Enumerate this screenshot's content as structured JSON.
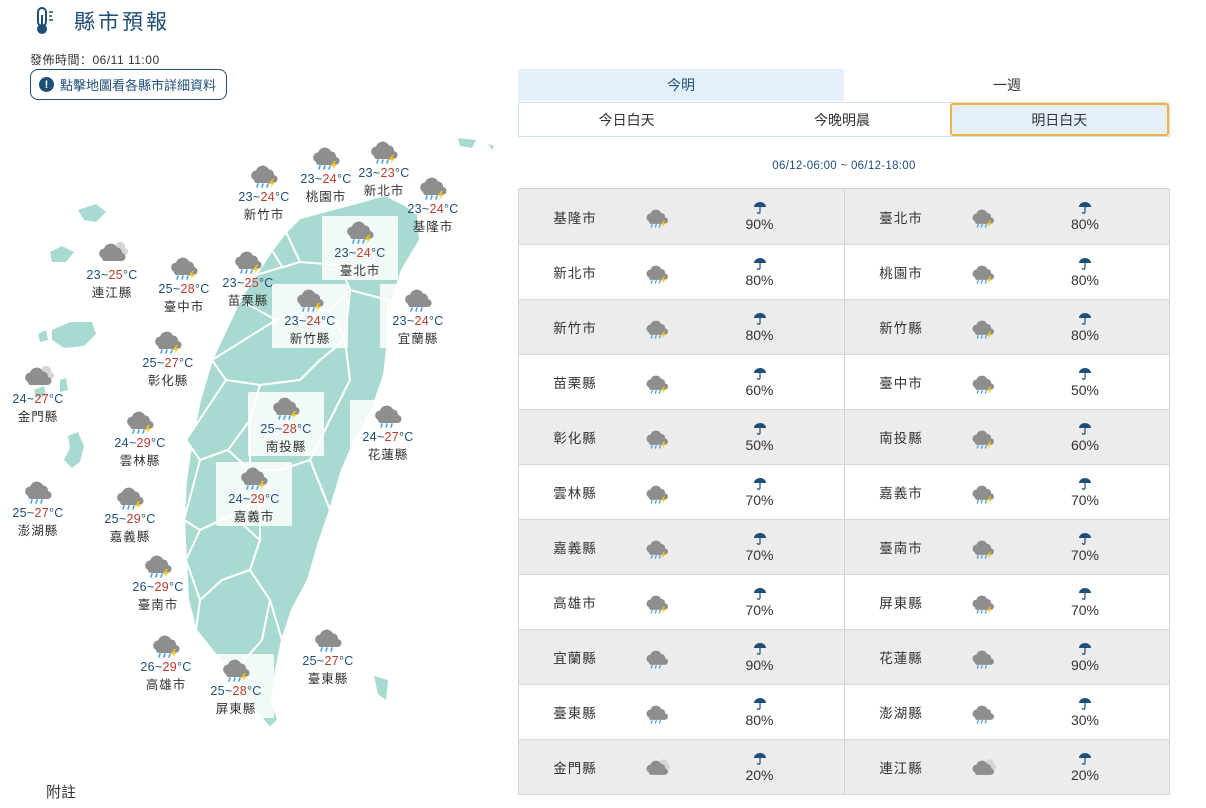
{
  "header": {
    "title": "縣市預報",
    "publish_time": "發佈時間：06/11 11:00",
    "hint": "點擊地圖看各縣市詳細資料",
    "icon": "thermometer-icon"
  },
  "note": "附註",
  "tabs_primary": [
    {
      "label": "今明",
      "active": true
    },
    {
      "label": "一週",
      "active": false
    }
  ],
  "tabs_secondary": [
    {
      "label": "今日白天",
      "active": false
    },
    {
      "label": "今晚明晨",
      "active": false
    },
    {
      "label": "明日白天",
      "active": true
    }
  ],
  "period": "06/12-06:00 ~ 06/12-18:00",
  "colors": {
    "accent": "#1f4e79",
    "tab_active_bg": "#e3f0fb",
    "tab_active_border": "#f0b43c",
    "map_land": "#a8dad1",
    "high_temp": "#c0392b",
    "low_temp": "#1f4e79"
  },
  "map_cities": [
    {
      "name": "新竹市",
      "low": "23",
      "high": "24",
      "unit": "°C",
      "icon": "thunder-rain"
    },
    {
      "name": "桃園市",
      "low": "23",
      "high": "24",
      "unit": "°C",
      "icon": "thunder-rain"
    },
    {
      "name": "新北市",
      "low": "23",
      "high": "23",
      "unit": "°C",
      "icon": "thunder-rain"
    },
    {
      "name": "基隆市",
      "low": "23",
      "high": "24",
      "unit": "°C",
      "icon": "thunder-rain"
    },
    {
      "name": "臺北市",
      "low": "23",
      "high": "24",
      "unit": "°C",
      "icon": "thunder-rain"
    },
    {
      "name": "連江縣",
      "low": "23",
      "high": "25",
      "unit": "°C",
      "icon": "cloudy"
    },
    {
      "name": "臺中市",
      "low": "25",
      "high": "28",
      "unit": "°C",
      "icon": "thunder-rain"
    },
    {
      "name": "苗栗縣",
      "low": "23",
      "high": "25",
      "unit": "°C",
      "icon": "thunder-rain"
    },
    {
      "name": "新竹縣",
      "low": "23",
      "high": "24",
      "unit": "°C",
      "icon": "thunder-rain"
    },
    {
      "name": "宜蘭縣",
      "low": "23",
      "high": "24",
      "unit": "°C",
      "icon": "rain"
    },
    {
      "name": "彰化縣",
      "low": "25",
      "high": "27",
      "unit": "°C",
      "icon": "thunder-rain"
    },
    {
      "name": "金門縣",
      "low": "24",
      "high": "27",
      "unit": "°C",
      "icon": "cloudy"
    },
    {
      "name": "南投縣",
      "low": "25",
      "high": "28",
      "unit": "°C",
      "icon": "thunder-rain"
    },
    {
      "name": "花蓮縣",
      "low": "24",
      "high": "27",
      "unit": "°C",
      "icon": "rain"
    },
    {
      "name": "雲林縣",
      "low": "24",
      "high": "29",
      "unit": "°C",
      "icon": "thunder-rain"
    },
    {
      "name": "嘉義縣",
      "low": "25",
      "high": "29",
      "unit": "°C",
      "icon": "thunder-rain"
    },
    {
      "name": "嘉義市",
      "low": "24",
      "high": "29",
      "unit": "°C",
      "icon": "thunder-rain"
    },
    {
      "name": "澎湖縣",
      "low": "25",
      "high": "27",
      "unit": "°C",
      "icon": "rain"
    },
    {
      "name": "臺南市",
      "low": "26",
      "high": "29",
      "unit": "°C",
      "icon": "thunder-rain"
    },
    {
      "name": "高雄市",
      "low": "26",
      "high": "29",
      "unit": "°C",
      "icon": "thunder-rain"
    },
    {
      "name": "屏東縣",
      "low": "25",
      "high": "28",
      "unit": "°C",
      "icon": "thunder-rain"
    },
    {
      "name": "臺東縣",
      "low": "25",
      "high": "27",
      "unit": "°C",
      "icon": "rain"
    }
  ],
  "forecast_rows": [
    [
      {
        "name": "基隆市",
        "icon": "thunder-rain",
        "rain": "90%"
      },
      {
        "name": "臺北市",
        "icon": "thunder-rain",
        "rain": "80%"
      }
    ],
    [
      {
        "name": "新北市",
        "icon": "thunder-rain",
        "rain": "80%"
      },
      {
        "name": "桃園市",
        "icon": "thunder-rain",
        "rain": "80%"
      }
    ],
    [
      {
        "name": "新竹市",
        "icon": "thunder-rain",
        "rain": "80%"
      },
      {
        "name": "新竹縣",
        "icon": "thunder-rain",
        "rain": "80%"
      }
    ],
    [
      {
        "name": "苗栗縣",
        "icon": "thunder-rain",
        "rain": "60%"
      },
      {
        "name": "臺中市",
        "icon": "thunder-rain",
        "rain": "50%"
      }
    ],
    [
      {
        "name": "彰化縣",
        "icon": "thunder-rain",
        "rain": "50%"
      },
      {
        "name": "南投縣",
        "icon": "thunder-rain",
        "rain": "60%"
      }
    ],
    [
      {
        "name": "雲林縣",
        "icon": "thunder-rain",
        "rain": "70%"
      },
      {
        "name": "嘉義市",
        "icon": "thunder-rain",
        "rain": "70%"
      }
    ],
    [
      {
        "name": "嘉義縣",
        "icon": "thunder-rain",
        "rain": "70%"
      },
      {
        "name": "臺南市",
        "icon": "thunder-rain",
        "rain": "70%"
      }
    ],
    [
      {
        "name": "高雄市",
        "icon": "thunder-rain",
        "rain": "70%"
      },
      {
        "name": "屏東縣",
        "icon": "thunder-rain",
        "rain": "70%"
      }
    ],
    [
      {
        "name": "宜蘭縣",
        "icon": "rain",
        "rain": "90%"
      },
      {
        "name": "花蓮縣",
        "icon": "rain",
        "rain": "90%"
      }
    ],
    [
      {
        "name": "臺東縣",
        "icon": "rain",
        "rain": "80%"
      },
      {
        "name": "澎湖縣",
        "icon": "rain",
        "rain": "30%"
      }
    ],
    [
      {
        "name": "金門縣",
        "icon": "cloudy",
        "rain": "20%"
      },
      {
        "name": "連江縣",
        "icon": "cloudy",
        "rain": "20%"
      }
    ]
  ]
}
